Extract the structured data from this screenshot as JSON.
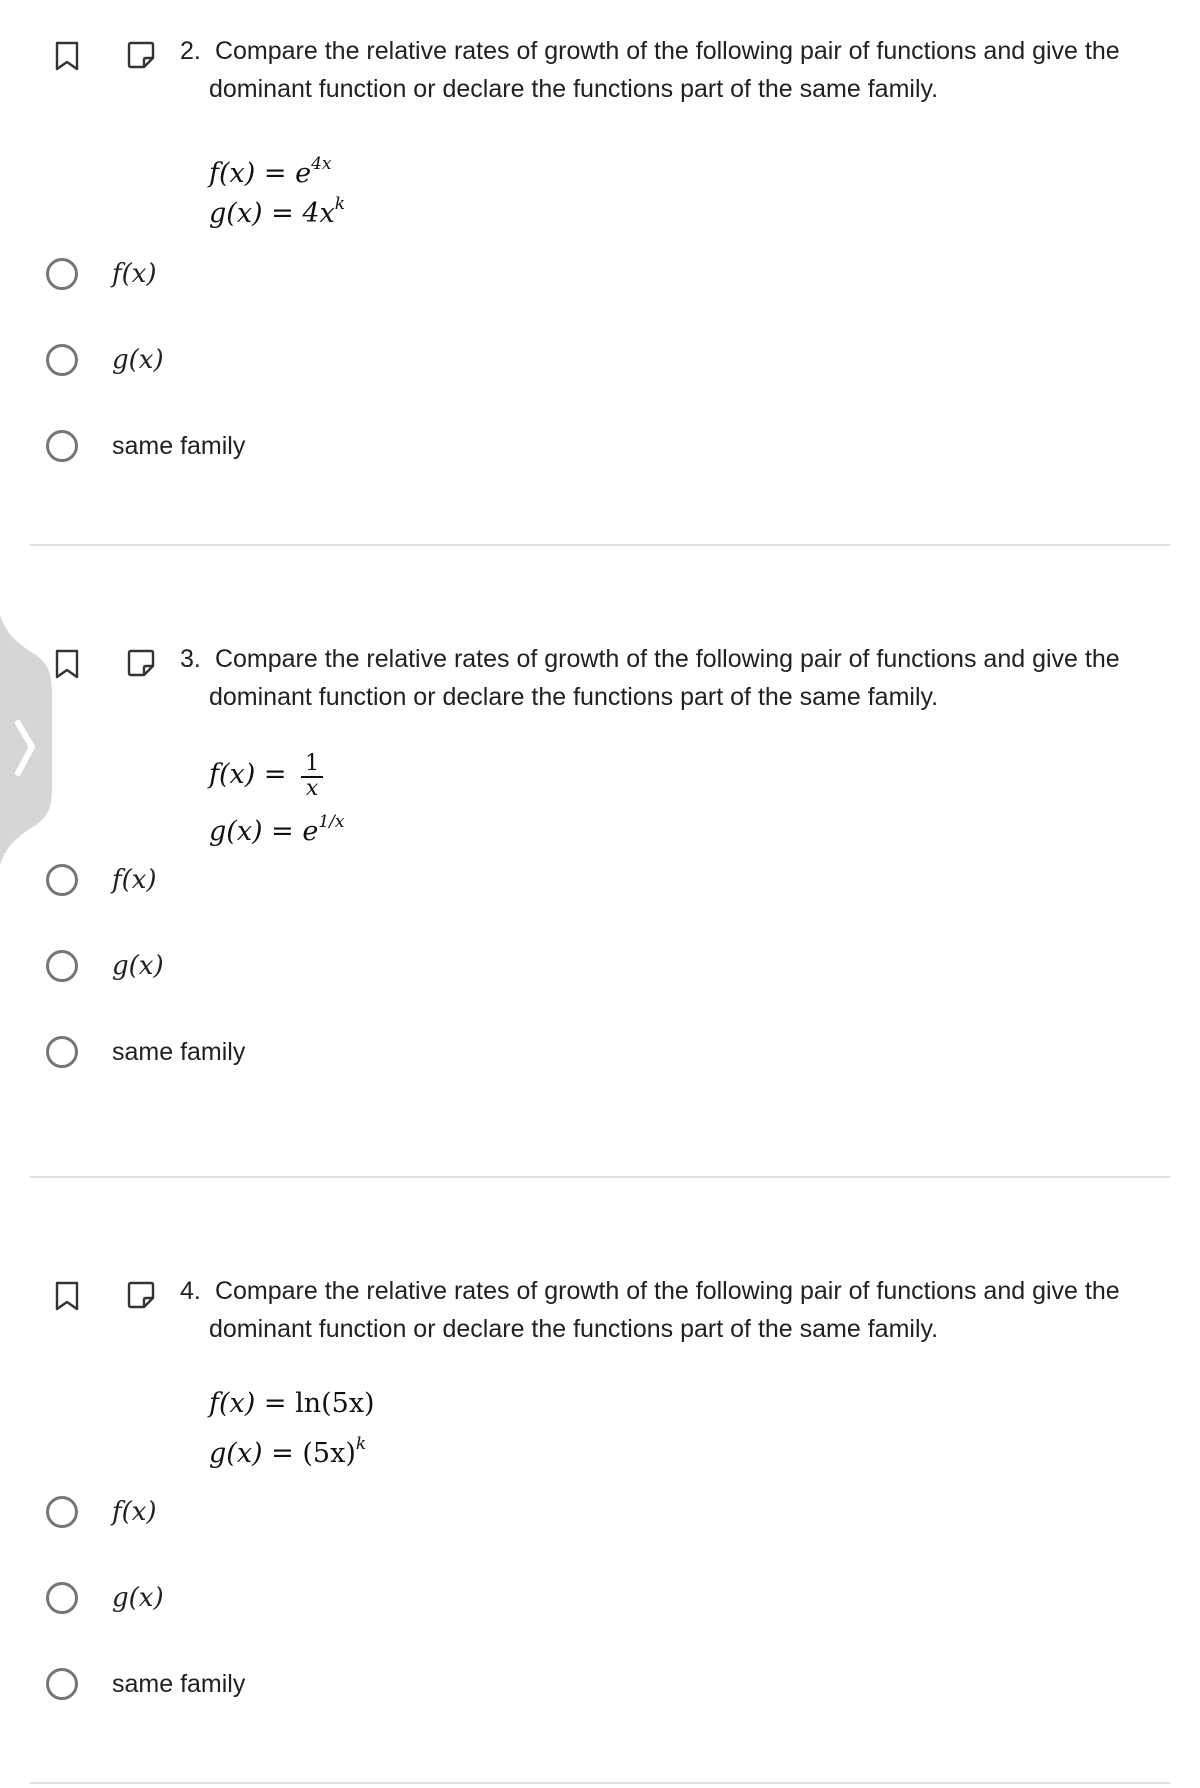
{
  "questions": [
    {
      "number": "2.",
      "text_line1": "Compare the relative rates of growth of the following pair of functions and give the",
      "text_line2": "dominant function or declare the functions part of the same family.",
      "f_lhs": "f(x) = ",
      "f_rhs_base": "e",
      "f_rhs_exp": "4x",
      "g_lhs": "g(x) = ",
      "g_rhs_base": "4x",
      "g_rhs_exp": "k",
      "options": [
        "f(x)",
        "g(x)",
        "same family"
      ]
    },
    {
      "number": "3.",
      "text_line1": "Compare the relative rates of growth of the following pair of functions and give the",
      "text_line2": "dominant function or declare the functions part of the same family.",
      "f_lhs": "f(x) = ",
      "f_frac_num": "1",
      "f_frac_den": "x",
      "g_lhs": "g(x) = ",
      "g_rhs_base": "e",
      "g_rhs_exp": "1/x",
      "options": [
        "f(x)",
        "g(x)",
        "same family"
      ]
    },
    {
      "number": "4.",
      "text_line1": "Compare the relative rates of growth of the following pair of functions and give the",
      "text_line2": "dominant function or declare the functions part of the same family.",
      "f_lhs": "f(x) = ",
      "f_rhs": "ln(5x)",
      "g_lhs": "g(x) = ",
      "g_rhs_base": "(5x)",
      "g_rhs_exp": "k",
      "options": [
        "f(x)",
        "g(x)",
        "same family"
      ]
    }
  ],
  "side_panel": {
    "icon": "chevron-right-icon"
  },
  "colors": {
    "text": "#202124",
    "radio_border": "#757575",
    "divider": "#e0e0e0",
    "side_tab": "#d6d6d6"
  }
}
